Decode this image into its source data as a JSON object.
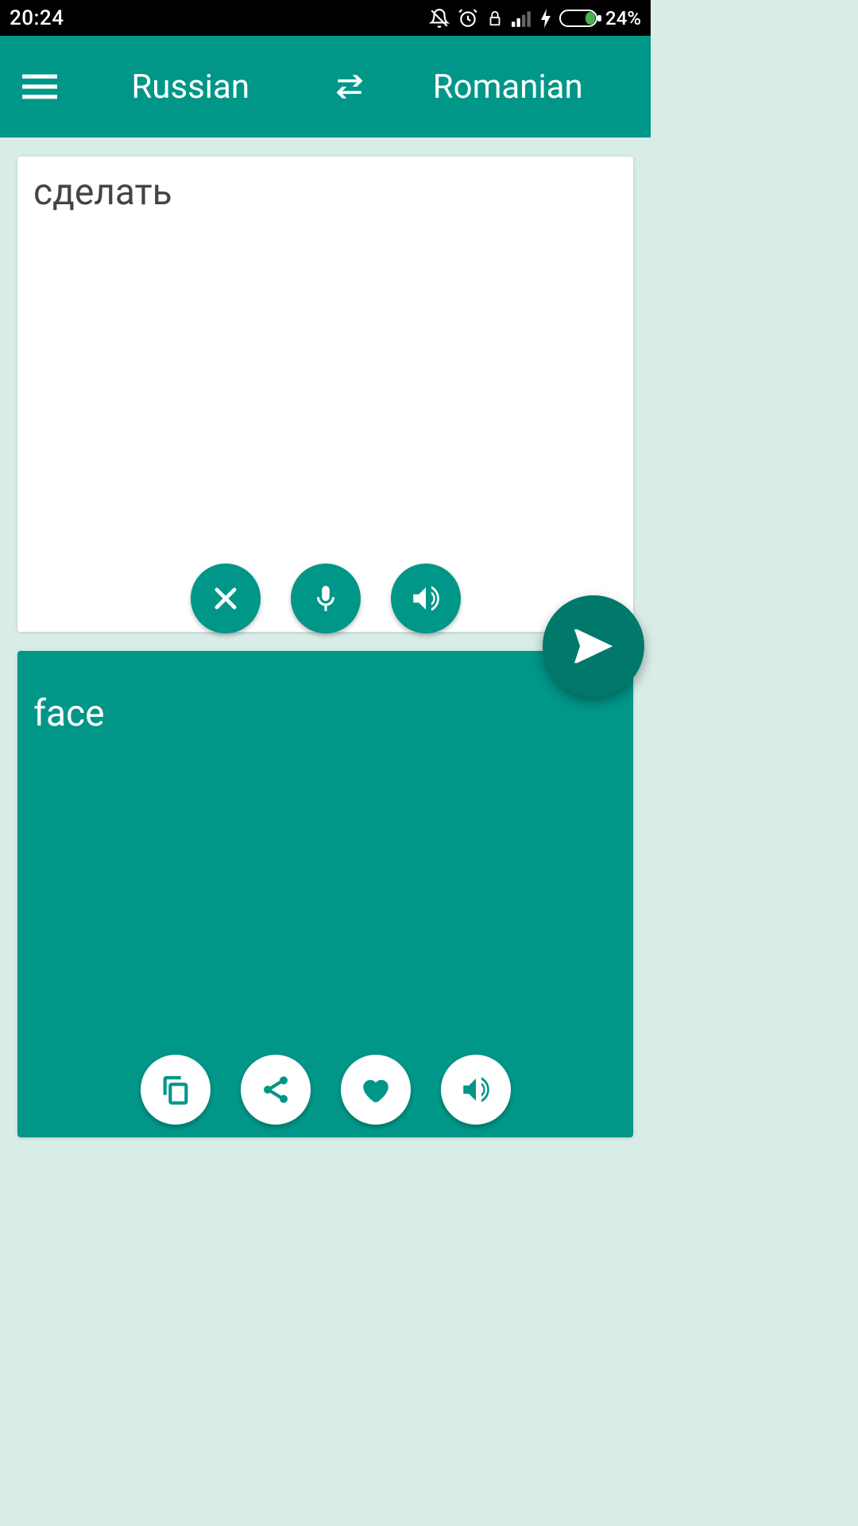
{
  "status": {
    "time": "20:24",
    "battery_pct": "24%"
  },
  "header": {
    "source_lang": "Russian",
    "target_lang": "Romanian"
  },
  "input": {
    "text": "сделать"
  },
  "output": {
    "text": "face"
  },
  "icons": {
    "menu": "menu",
    "swap": "swap",
    "clear": "close",
    "mic": "microphone",
    "speaker": "volume",
    "send": "send",
    "copy": "copy",
    "share": "share",
    "favorite": "heart"
  }
}
